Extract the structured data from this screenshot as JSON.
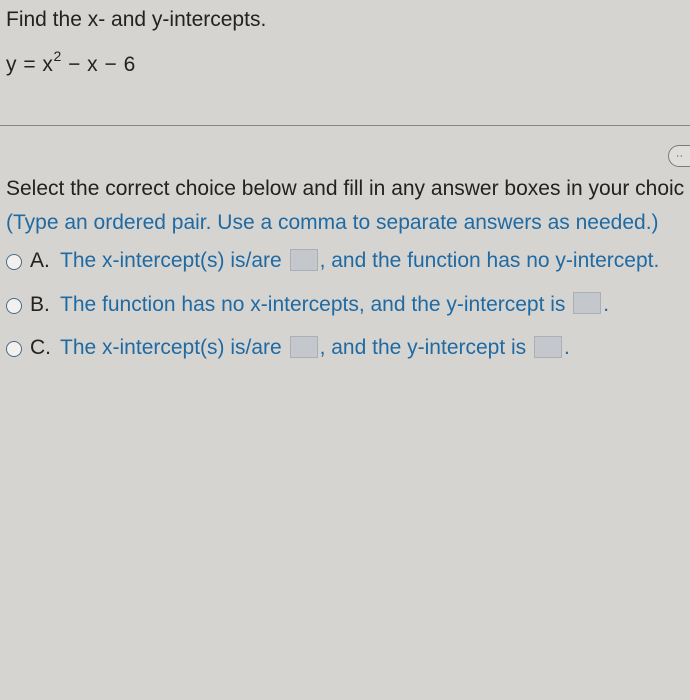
{
  "prompt": "Find the x- and y-intercepts.",
  "equation": {
    "lhs": "y = x",
    "exp": "2",
    "rhs": " − x − 6"
  },
  "instr1": "Select the correct choice below and fill in any answer boxes in your choic",
  "instr2": "(Type an ordered pair. Use a comma to separate answers as needed.)",
  "options": {
    "A": {
      "letter": "A.",
      "t1": "The x-intercept(s) is/are ",
      "t2": ", and the function has no y-intercept."
    },
    "B": {
      "letter": "B.",
      "t1": "The function has no x-intercepts, and the y-intercept is ",
      "t2": "."
    },
    "C": {
      "letter": "C.",
      "t1": "The x-intercept(s) is/are ",
      "t2": ", and the y-intercept is ",
      "t3": "."
    }
  },
  "widget_glyph": "··"
}
